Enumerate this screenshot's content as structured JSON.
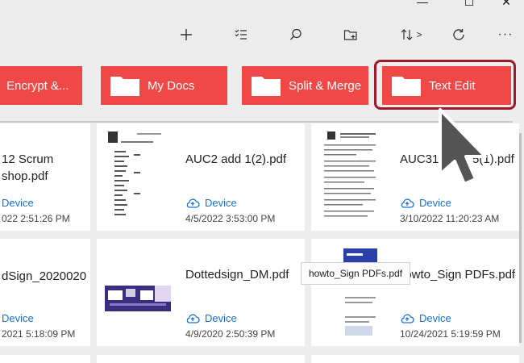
{
  "window": {
    "minimize_glyph": "—",
    "maximize_glyph": "☐",
    "close_glyph": "✕"
  },
  "toolbar": {
    "buttons": [
      {
        "name": "add-icon"
      },
      {
        "name": "select-list-icon"
      },
      {
        "name": "search-icon"
      },
      {
        "name": "new-folder-icon"
      },
      {
        "name": "sort-icon",
        "suffix": ">"
      },
      {
        "name": "refresh-icon"
      },
      {
        "name": "more-icon",
        "glyph": "···"
      }
    ]
  },
  "folders": [
    {
      "label": "Encrypt &..."
    },
    {
      "label": "My Docs"
    },
    {
      "label": "Split & Merge"
    },
    {
      "label": "Text Edit"
    }
  ],
  "files": [
    {
      "title_line1": "12 Scrum",
      "title_line2": "shop.pdf",
      "location": "Device",
      "date": "022 2:51:26 PM"
    },
    {
      "title_line1": "AUC2 add 1(2).pdf",
      "location": "Device",
      "date": "4/5/2022 3:53:00 PM"
    },
    {
      "title_line1": "AUC310 add 5(1).pdf",
      "location": "Device",
      "date": "3/10/2022 11:20:23 AM"
    },
    {
      "title_line1": "dSign_2020020",
      "location": "Device",
      "date": "2021 5:18:09 PM"
    },
    {
      "title_line1": "Dottedsign_DM.pdf",
      "location": "Device",
      "date": "4/9/2020 2:50:39 PM"
    },
    {
      "title_line1": "howto_Sign PDFs.pdf",
      "location": "Device",
      "date": "10/24/2021 5:19:59 PM"
    }
  ],
  "tooltip": {
    "text": "howto_Sign PDFs.pdf"
  },
  "colors": {
    "folder_red": "#f04747",
    "highlight_border": "#a0182a",
    "link_blue": "#1a6fd6"
  }
}
